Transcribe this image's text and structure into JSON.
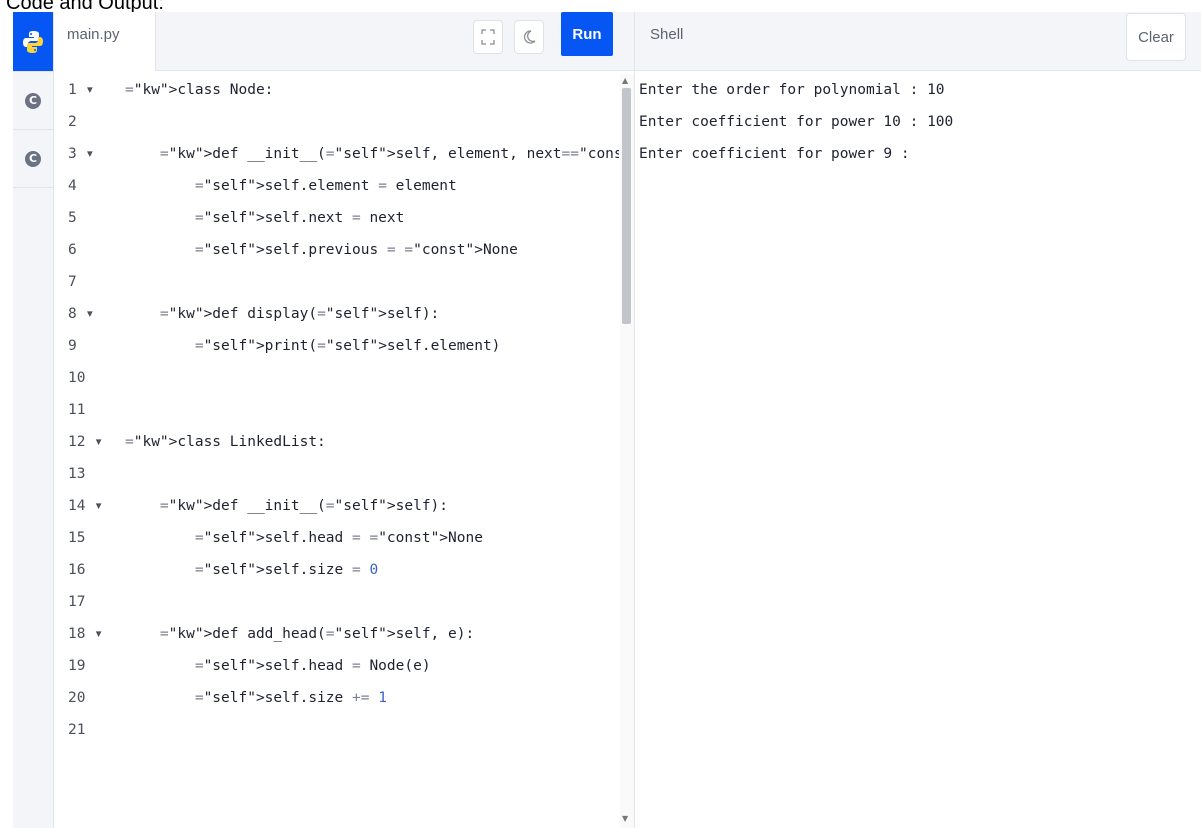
{
  "caption": "Code and Output:",
  "sidebar": {
    "languages": [
      {
        "name": "python",
        "icon": "python-icon",
        "active": true
      },
      {
        "name": "c",
        "icon": "c-icon",
        "glyph": "C",
        "active": false
      },
      {
        "name": "cpp",
        "icon": "c-icon",
        "glyph": "C",
        "active": false
      }
    ]
  },
  "editor": {
    "file_name": "main.py",
    "fullscreen_icon": "fullscreen-icon",
    "theme_icon": "moon-icon",
    "run_label": "Run",
    "lines": [
      {
        "n": "1",
        "fold": true,
        "code": "class Node:"
      },
      {
        "n": "2",
        "fold": false,
        "code": ""
      },
      {
        "n": "3",
        "fold": true,
        "code": "    def __init__(self, element, next=None):"
      },
      {
        "n": "4",
        "fold": false,
        "code": "        self.element = element"
      },
      {
        "n": "5",
        "fold": false,
        "code": "        self.next = next"
      },
      {
        "n": "6",
        "fold": false,
        "code": "        self.previous = None"
      },
      {
        "n": "7",
        "fold": false,
        "code": ""
      },
      {
        "n": "8",
        "fold": true,
        "code": "    def display(self):"
      },
      {
        "n": "9",
        "fold": false,
        "code": "        print(self.element)"
      },
      {
        "n": "10",
        "fold": false,
        "code": ""
      },
      {
        "n": "11",
        "fold": false,
        "code": ""
      },
      {
        "n": "12",
        "fold": true,
        "code": "class LinkedList:"
      },
      {
        "n": "13",
        "fold": false,
        "code": ""
      },
      {
        "n": "14",
        "fold": true,
        "code": "    def __init__(self):"
      },
      {
        "n": "15",
        "fold": false,
        "code": "        self.head = None"
      },
      {
        "n": "16",
        "fold": false,
        "code": "        self.size = 0"
      },
      {
        "n": "17",
        "fold": false,
        "code": ""
      },
      {
        "n": "18",
        "fold": true,
        "code": "    def add_head(self, e):"
      },
      {
        "n": "19",
        "fold": false,
        "code": "        self.head = Node(e)"
      },
      {
        "n": "20",
        "fold": false,
        "code": "        self.size += 1"
      },
      {
        "n": "21",
        "fold": false,
        "code": ""
      }
    ]
  },
  "shell": {
    "title": "Shell",
    "clear_label": "Clear",
    "output": [
      "Enter the order for polynomial : 10",
      "Enter coefficient for power 10 : 100",
      "Enter coefficient for power 9 :"
    ]
  },
  "colors": {
    "accent": "#0556f3",
    "keyword": "#2c3aa0",
    "self": "#3b61c9"
  }
}
